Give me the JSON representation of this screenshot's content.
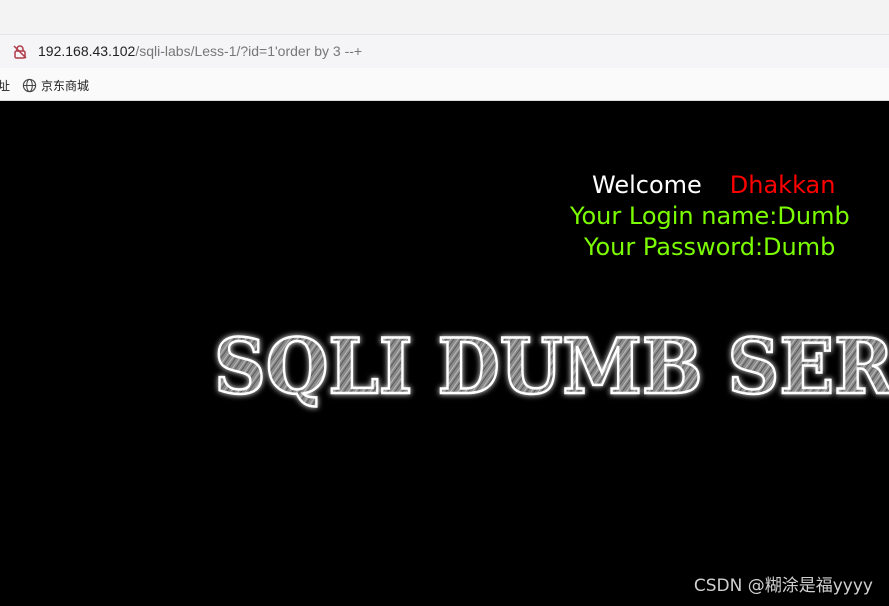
{
  "browser": {
    "url_host": "192.168.43.102",
    "url_path": "/sqli-labs/Less-1/?id=1'order by 3 --+",
    "security_icon": "not-secure-lock-icon",
    "bookmarks": {
      "partial_label": "址",
      "items": [
        {
          "icon": "globe-icon",
          "label": "京东商城"
        }
      ]
    }
  },
  "page": {
    "welcome_word": "Welcome",
    "welcome_name": "Dhakkan",
    "login_line": "Your Login name:Dumb",
    "password_line": "Your Password:Dumb",
    "banner_text": "SQLI DUMB SERIES",
    "colors": {
      "background": "#000000",
      "welcome": "#ffffff",
      "name": "#ff0000",
      "credentials": "#7cfc00"
    }
  },
  "watermark": "CSDN @糊涂是福yyyy"
}
